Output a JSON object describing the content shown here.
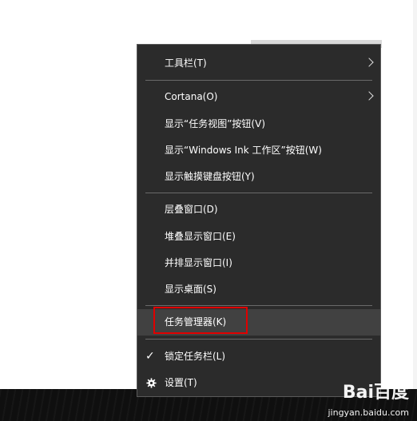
{
  "menu": {
    "items": [
      {
        "label": "工具栏(T)",
        "submenu": true
      },
      {
        "label": "Cortana(O)",
        "submenu": true
      },
      {
        "label": "显示“任务视图”按钮(V)"
      },
      {
        "label": "显示“Windows Ink 工作区”按钮(W)"
      },
      {
        "label": "显示触摸键盘按钮(Y)"
      },
      {
        "label": "层叠窗口(D)"
      },
      {
        "label": "堆叠显示窗口(E)"
      },
      {
        "label": "并排显示窗口(I)"
      },
      {
        "label": "显示桌面(S)"
      },
      {
        "label": "任务管理器(K)",
        "highlighted": true
      },
      {
        "label": "锁定任务栏(L)",
        "checked": true
      },
      {
        "label": "设置(T)",
        "icon": "gear-icon"
      }
    ]
  },
  "watermark": {
    "brand": "Bai百度",
    "site": "jingyan.baidu.com"
  },
  "colors": {
    "menu_bg": "#2b2b2b",
    "hover_bg": "#414141",
    "highlight_border": "#e00000",
    "text": "#ffffff"
  }
}
